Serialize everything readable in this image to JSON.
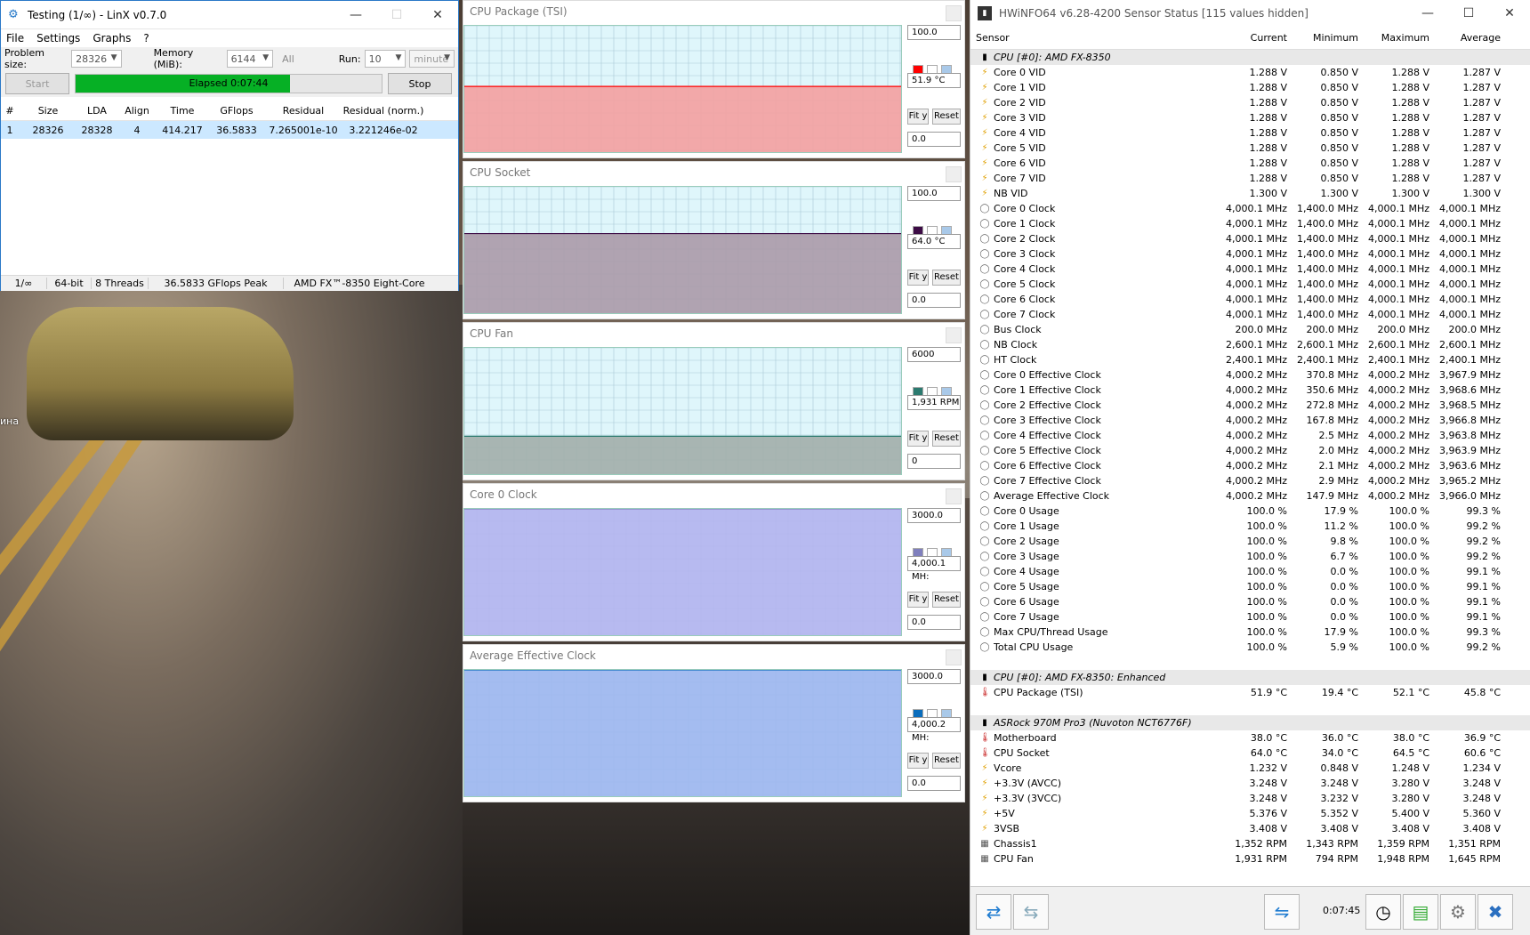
{
  "desktop": {
    "label": "ина"
  },
  "linx": {
    "title": "Testing (1/∞) - LinX v0.7.0",
    "menu": [
      "File",
      "Settings",
      "Graphs",
      "?"
    ],
    "problem_size_label": "Problem size:",
    "problem_size_value": "28326",
    "memory_label": "Memory (MiB):",
    "memory_value": "6144",
    "all_label": "All",
    "run_label": "Run:",
    "run_value": "10",
    "run_unit": "minute",
    "start_label": "Start",
    "stop_label": "Stop",
    "elapsed_label": "Elapsed 0:07:44",
    "progress_fraction": 0.7,
    "columns": [
      "#",
      "Size",
      "LDA",
      "Align",
      "Time",
      "GFlops",
      "Residual",
      "Residual (norm.)"
    ],
    "rows": [
      [
        "1",
        "28326",
        "28328",
        "4",
        "414.217",
        "36.5833",
        "7.265001e-10",
        "3.221246e-02"
      ]
    ],
    "status": [
      "1/∞",
      "64-bit",
      "8 Threads",
      "36.5833 GFlops Peak",
      "AMD FX™-8350 Eight-Core"
    ]
  },
  "graphs": [
    {
      "title": "CPU Package (TSI)",
      "max": "100.0",
      "current": "51.9 °C",
      "min": "0.0",
      "color": "#ff0000",
      "fill": "#f4a0a0",
      "level": 0.52,
      "fit": "Fit y",
      "reset": "Reset"
    },
    {
      "title": "CPU Socket",
      "max": "100.0",
      "current": "64.0 °C",
      "min": "0.0",
      "color": "#3c0b45",
      "fill": "#ab9aa9",
      "level": 0.63,
      "fit": "Fit y",
      "reset": "Reset"
    },
    {
      "title": "CPU Fan",
      "max": "6000",
      "current": "1,931 RPM",
      "min": "0",
      "color": "#2b7a6f",
      "fill": "#a2aeaa",
      "level": 0.3,
      "fit": "Fit y",
      "reset": "Reset"
    },
    {
      "title": "Core 0 Clock",
      "max": "3000.0",
      "current": "4,000.1 MH:",
      "min": "0.0",
      "color": "#7f7fbd",
      "fill": "#b2b4ee",
      "level": 1.0,
      "fit": "Fit y",
      "reset": "Reset"
    },
    {
      "title": "Average Effective Clock",
      "max": "3000.0",
      "current": "4,000.2 MH:",
      "min": "0.0",
      "color": "#0a6dbd",
      "fill": "#9db6ee",
      "level": 1.0,
      "fit": "Fit y",
      "reset": "Reset"
    }
  ],
  "hwinfo": {
    "title": "HWiNFO64 v6.28-4200 Sensor Status [115 values hidden]",
    "columns": [
      "Sensor",
      "Current",
      "Minimum",
      "Maximum",
      "Average"
    ],
    "rows": [
      {
        "type": "group",
        "name": "CPU [#0]: AMD FX-8350"
      },
      {
        "icon": "volt",
        "name": "Core 0 VID",
        "cur": "1.288 V",
        "min": "0.850 V",
        "max": "1.288 V",
        "avg": "1.287 V"
      },
      {
        "icon": "volt",
        "name": "Core 1 VID",
        "cur": "1.288 V",
        "min": "0.850 V",
        "max": "1.288 V",
        "avg": "1.287 V"
      },
      {
        "icon": "volt",
        "name": "Core 2 VID",
        "cur": "1.288 V",
        "min": "0.850 V",
        "max": "1.288 V",
        "avg": "1.287 V"
      },
      {
        "icon": "volt",
        "name": "Core 3 VID",
        "cur": "1.288 V",
        "min": "0.850 V",
        "max": "1.288 V",
        "avg": "1.287 V"
      },
      {
        "icon": "volt",
        "name": "Core 4 VID",
        "cur": "1.288 V",
        "min": "0.850 V",
        "max": "1.288 V",
        "avg": "1.287 V"
      },
      {
        "icon": "volt",
        "name": "Core 5 VID",
        "cur": "1.288 V",
        "min": "0.850 V",
        "max": "1.288 V",
        "avg": "1.287 V"
      },
      {
        "icon": "volt",
        "name": "Core 6 VID",
        "cur": "1.288 V",
        "min": "0.850 V",
        "max": "1.288 V",
        "avg": "1.287 V"
      },
      {
        "icon": "volt",
        "name": "Core 7 VID",
        "cur": "1.288 V",
        "min": "0.850 V",
        "max": "1.288 V",
        "avg": "1.287 V"
      },
      {
        "icon": "volt",
        "name": "NB VID",
        "cur": "1.300 V",
        "min": "1.300 V",
        "max": "1.300 V",
        "avg": "1.300 V"
      },
      {
        "icon": "clock",
        "name": "Core 0 Clock",
        "cur": "4,000.1 MHz",
        "min": "1,400.0 MHz",
        "max": "4,000.1 MHz",
        "avg": "4,000.1 MHz"
      },
      {
        "icon": "clock",
        "name": "Core 1 Clock",
        "cur": "4,000.1 MHz",
        "min": "1,400.0 MHz",
        "max": "4,000.1 MHz",
        "avg": "4,000.1 MHz"
      },
      {
        "icon": "clock",
        "name": "Core 2 Clock",
        "cur": "4,000.1 MHz",
        "min": "1,400.0 MHz",
        "max": "4,000.1 MHz",
        "avg": "4,000.1 MHz"
      },
      {
        "icon": "clock",
        "name": "Core 3 Clock",
        "cur": "4,000.1 MHz",
        "min": "1,400.0 MHz",
        "max": "4,000.1 MHz",
        "avg": "4,000.1 MHz"
      },
      {
        "icon": "clock",
        "name": "Core 4 Clock",
        "cur": "4,000.1 MHz",
        "min": "1,400.0 MHz",
        "max": "4,000.1 MHz",
        "avg": "4,000.1 MHz"
      },
      {
        "icon": "clock",
        "name": "Core 5 Clock",
        "cur": "4,000.1 MHz",
        "min": "1,400.0 MHz",
        "max": "4,000.1 MHz",
        "avg": "4,000.1 MHz"
      },
      {
        "icon": "clock",
        "name": "Core 6 Clock",
        "cur": "4,000.1 MHz",
        "min": "1,400.0 MHz",
        "max": "4,000.1 MHz",
        "avg": "4,000.1 MHz"
      },
      {
        "icon": "clock",
        "name": "Core 7 Clock",
        "cur": "4,000.1 MHz",
        "min": "1,400.0 MHz",
        "max": "4,000.1 MHz",
        "avg": "4,000.1 MHz"
      },
      {
        "icon": "clock",
        "name": "Bus Clock",
        "cur": "200.0 MHz",
        "min": "200.0 MHz",
        "max": "200.0 MHz",
        "avg": "200.0 MHz"
      },
      {
        "icon": "clock",
        "name": "NB Clock",
        "cur": "2,600.1 MHz",
        "min": "2,600.1 MHz",
        "max": "2,600.1 MHz",
        "avg": "2,600.1 MHz"
      },
      {
        "icon": "clock",
        "name": "HT Clock",
        "cur": "2,400.1 MHz",
        "min": "2,400.1 MHz",
        "max": "2,400.1 MHz",
        "avg": "2,400.1 MHz"
      },
      {
        "icon": "clock",
        "name": "Core 0 Effective Clock",
        "cur": "4,000.2 MHz",
        "min": "370.8 MHz",
        "max": "4,000.2 MHz",
        "avg": "3,967.9 MHz"
      },
      {
        "icon": "clock",
        "name": "Core 1 Effective Clock",
        "cur": "4,000.2 MHz",
        "min": "350.6 MHz",
        "max": "4,000.2 MHz",
        "avg": "3,968.6 MHz"
      },
      {
        "icon": "clock",
        "name": "Core 2 Effective Clock",
        "cur": "4,000.2 MHz",
        "min": "272.8 MHz",
        "max": "4,000.2 MHz",
        "avg": "3,968.5 MHz"
      },
      {
        "icon": "clock",
        "name": "Core 3 Effective Clock",
        "cur": "4,000.2 MHz",
        "min": "167.8 MHz",
        "max": "4,000.2 MHz",
        "avg": "3,966.8 MHz"
      },
      {
        "icon": "clock",
        "name": "Core 4 Effective Clock",
        "cur": "4,000.2 MHz",
        "min": "2.5 MHz",
        "max": "4,000.2 MHz",
        "avg": "3,963.8 MHz"
      },
      {
        "icon": "clock",
        "name": "Core 5 Effective Clock",
        "cur": "4,000.2 MHz",
        "min": "2.0 MHz",
        "max": "4,000.2 MHz",
        "avg": "3,963.9 MHz"
      },
      {
        "icon": "clock",
        "name": "Core 6 Effective Clock",
        "cur": "4,000.2 MHz",
        "min": "2.1 MHz",
        "max": "4,000.2 MHz",
        "avg": "3,963.6 MHz"
      },
      {
        "icon": "clock",
        "name": "Core 7 Effective Clock",
        "cur": "4,000.2 MHz",
        "min": "2.9 MHz",
        "max": "4,000.2 MHz",
        "avg": "3,965.2 MHz"
      },
      {
        "icon": "clock",
        "name": "Average Effective Clock",
        "cur": "4,000.2 MHz",
        "min": "147.9 MHz",
        "max": "4,000.2 MHz",
        "avg": "3,966.0 MHz"
      },
      {
        "icon": "clock",
        "name": "Core 0 Usage",
        "cur": "100.0 %",
        "min": "17.9 %",
        "max": "100.0 %",
        "avg": "99.3 %"
      },
      {
        "icon": "clock",
        "name": "Core 1 Usage",
        "cur": "100.0 %",
        "min": "11.2 %",
        "max": "100.0 %",
        "avg": "99.2 %"
      },
      {
        "icon": "clock",
        "name": "Core 2 Usage",
        "cur": "100.0 %",
        "min": "9.8 %",
        "max": "100.0 %",
        "avg": "99.2 %"
      },
      {
        "icon": "clock",
        "name": "Core 3 Usage",
        "cur": "100.0 %",
        "min": "6.7 %",
        "max": "100.0 %",
        "avg": "99.2 %"
      },
      {
        "icon": "clock",
        "name": "Core 4 Usage",
        "cur": "100.0 %",
        "min": "0.0 %",
        "max": "100.0 %",
        "avg": "99.1 %"
      },
      {
        "icon": "clock",
        "name": "Core 5 Usage",
        "cur": "100.0 %",
        "min": "0.0 %",
        "max": "100.0 %",
        "avg": "99.1 %"
      },
      {
        "icon": "clock",
        "name": "Core 6 Usage",
        "cur": "100.0 %",
        "min": "0.0 %",
        "max": "100.0 %",
        "avg": "99.1 %"
      },
      {
        "icon": "clock",
        "name": "Core 7 Usage",
        "cur": "100.0 %",
        "min": "0.0 %",
        "max": "100.0 %",
        "avg": "99.1 %"
      },
      {
        "icon": "clock",
        "name": "Max CPU/Thread Usage",
        "cur": "100.0 %",
        "min": "17.9 %",
        "max": "100.0 %",
        "avg": "99.3 %"
      },
      {
        "icon": "clock",
        "name": "Total CPU Usage",
        "cur": "100.0 %",
        "min": "5.9 %",
        "max": "100.0 %",
        "avg": "99.2 %"
      },
      {
        "type": "blank"
      },
      {
        "type": "group",
        "name": "CPU [#0]: AMD FX-8350: Enhanced"
      },
      {
        "icon": "temp",
        "name": "CPU Package (TSI)",
        "cur": "51.9 °C",
        "min": "19.4 °C",
        "max": "52.1 °C",
        "avg": "45.8 °C"
      },
      {
        "type": "blank"
      },
      {
        "type": "group",
        "name": "ASRock 970M Pro3 (Nuvoton NCT6776F)"
      },
      {
        "icon": "temp",
        "name": "Motherboard",
        "cur": "38.0 °C",
        "min": "36.0 °C",
        "max": "38.0 °C",
        "avg": "36.9 °C"
      },
      {
        "icon": "temp",
        "name": "CPU Socket",
        "cur": "64.0 °C",
        "min": "34.0 °C",
        "max": "64.5 °C",
        "avg": "60.6 °C"
      },
      {
        "icon": "volt",
        "name": "Vcore",
        "cur": "1.232 V",
        "min": "0.848 V",
        "max": "1.248 V",
        "avg": "1.234 V"
      },
      {
        "icon": "volt",
        "name": "+3.3V (AVCC)",
        "cur": "3.248 V",
        "min": "3.248 V",
        "max": "3.280 V",
        "avg": "3.248 V"
      },
      {
        "icon": "volt",
        "name": "+3.3V (3VCC)",
        "cur": "3.248 V",
        "min": "3.232 V",
        "max": "3.280 V",
        "avg": "3.248 V"
      },
      {
        "icon": "volt",
        "name": "+5V",
        "cur": "5.376 V",
        "min": "5.352 V",
        "max": "5.400 V",
        "avg": "5.360 V"
      },
      {
        "icon": "volt",
        "name": "3VSB",
        "cur": "3.408 V",
        "min": "3.408 V",
        "max": "3.408 V",
        "avg": "3.408 V"
      },
      {
        "icon": "fan",
        "name": "Chassis1",
        "cur": "1,352 RPM",
        "min": "1,343 RPM",
        "max": "1,359 RPM",
        "avg": "1,351 RPM"
      },
      {
        "icon": "fan",
        "name": "CPU Fan",
        "cur": "1,931 RPM",
        "min": "794 RPM",
        "max": "1,948 RPM",
        "avg": "1,645 RPM"
      }
    ],
    "elapsed": "0:07:45",
    "colors": {
      "accent": "#1e7bd0",
      "close": "#2a6fc0"
    }
  }
}
